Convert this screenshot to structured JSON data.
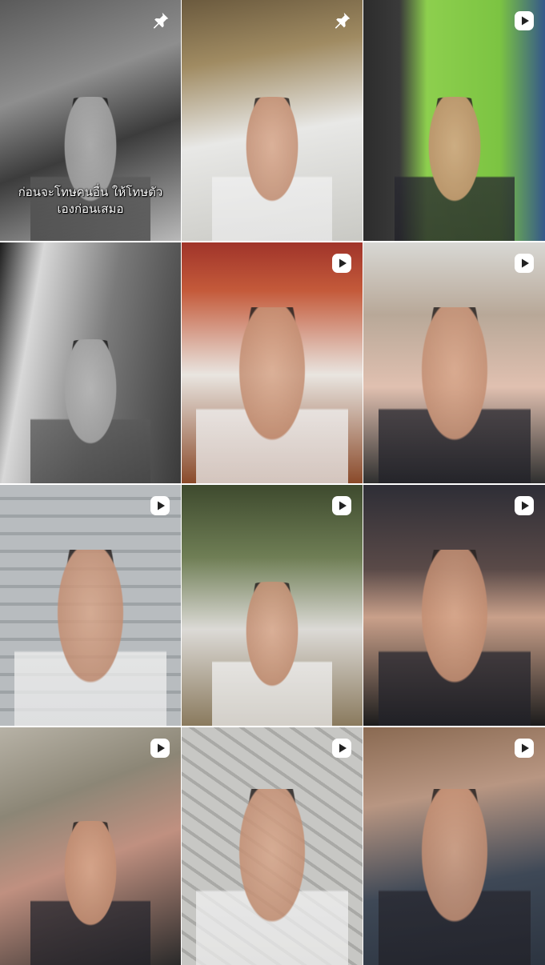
{
  "grid": {
    "tiles": [
      {
        "kind": "pinned",
        "icon": "pin-icon",
        "caption_line1": "ก่อนจะโทษคนอื่น ให้โทษตัว",
        "caption_line2": "เองก่อนเสมอ"
      },
      {
        "kind": "pinned",
        "icon": "pin-icon"
      },
      {
        "kind": "video",
        "icon": "play-icon"
      },
      {
        "kind": "photo"
      },
      {
        "kind": "video",
        "icon": "play-icon"
      },
      {
        "kind": "video",
        "icon": "play-icon"
      },
      {
        "kind": "video",
        "icon": "play-icon"
      },
      {
        "kind": "video",
        "icon": "play-icon"
      },
      {
        "kind": "video",
        "icon": "play-icon"
      },
      {
        "kind": "video",
        "icon": "play-icon"
      },
      {
        "kind": "video",
        "icon": "play-icon"
      },
      {
        "kind": "video",
        "icon": "play-icon"
      }
    ]
  },
  "colors": {
    "badge": "#ffffff",
    "gap": "#ffffff"
  }
}
